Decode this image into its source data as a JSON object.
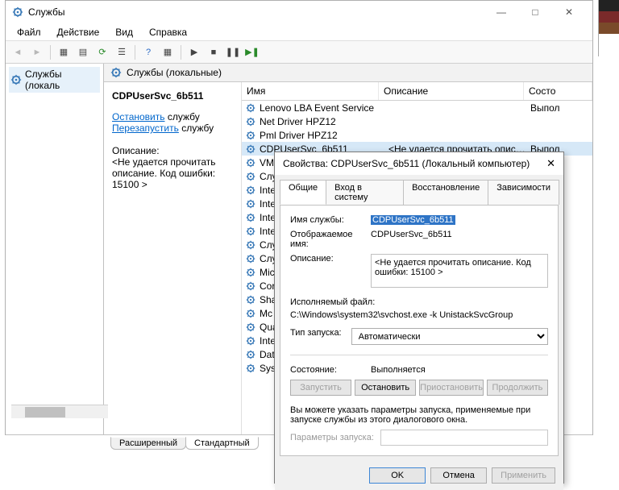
{
  "window": {
    "title": "Службы",
    "menu": [
      "Файл",
      "Действие",
      "Вид",
      "Справка"
    ],
    "win_ctrl": {
      "min": "—",
      "max": "□",
      "close": "✕"
    }
  },
  "tree": {
    "root": "Службы (локаль"
  },
  "main": {
    "header": "Службы (локальные)",
    "columns": {
      "name": "Имя",
      "desc": "Описание",
      "state": "Состо"
    },
    "tabs": {
      "ext": "Расширенный",
      "std": "Стандартный"
    }
  },
  "detail": {
    "svc": "CDPUserSvc_6b511",
    "stop_link": "Остановить",
    "stop_rest": " службу",
    "restart_link": "Перезапустить",
    "restart_rest": " службу",
    "desc_label": "Описание:",
    "desc_text": "<Не удается прочитать описание. Код ошибки: 15100 >"
  },
  "services": [
    {
      "name": "Lenovo LBA Event Service",
      "desc": "",
      "state": "Выпол"
    },
    {
      "name": "Net Driver HPZ12",
      "desc": "",
      "state": ""
    },
    {
      "name": "Pml Driver HPZ12",
      "desc": "",
      "state": ""
    },
    {
      "name": "CDPUserSvc_6b511",
      "desc": "<Не удается прочитать описание. Ко…",
      "state": "Выпол"
    },
    {
      "name": "VM",
      "desc": "",
      "state": ""
    },
    {
      "name": "Слу",
      "desc": "",
      "state": ""
    },
    {
      "name": "Inte",
      "desc": "",
      "state": ""
    },
    {
      "name": "Inte",
      "desc": "",
      "state": ""
    },
    {
      "name": "Inte",
      "desc": "",
      "state": ""
    },
    {
      "name": "Inte",
      "desc": "",
      "state": ""
    },
    {
      "name": "Слу",
      "desc": "",
      "state": ""
    },
    {
      "name": "Слу",
      "desc": "",
      "state": ""
    },
    {
      "name": "Mic",
      "desc": "",
      "state": ""
    },
    {
      "name": "Cor",
      "desc": "",
      "state": ""
    },
    {
      "name": "Sha",
      "desc": "",
      "state": ""
    },
    {
      "name": "Mc",
      "desc": "",
      "state": ""
    },
    {
      "name": "Qua",
      "desc": "",
      "state": ""
    },
    {
      "name": "Inte",
      "desc": "",
      "state": ""
    },
    {
      "name": "Data",
      "desc": "",
      "state": ""
    },
    {
      "name": "Syst",
      "desc": "",
      "state": ""
    }
  ],
  "dialog": {
    "title": "Свойства: CDPUserSvc_6b511 (Локальный компьютер)",
    "tabs": [
      "Общие",
      "Вход в систему",
      "Восстановление",
      "Зависимости"
    ],
    "name_lbl": "Имя службы:",
    "name_val": "CDPUserSvc_6b511",
    "disp_lbl": "Отображаемое имя:",
    "disp_val": "CDPUserSvc_6b511",
    "desc_lbl": "Описание:",
    "desc_val": "<Не удается прочитать описание. Код ошибки: 15100 >",
    "exe_lbl": "Исполняемый файл:",
    "exe_val": "C:\\Windows\\system32\\svchost.exe -k UnistackSvcGroup",
    "start_lbl": "Тип запуска:",
    "start_val": "Автоматически",
    "state_lbl": "Состояние:",
    "state_val": "Выполняется",
    "btns": {
      "run": "Запустить",
      "stop": "Остановить",
      "pause": "Приостановить",
      "cont": "Продолжить"
    },
    "hint": "Вы можете указать параметры запуска, применяемые при запуске службы из этого диалогового окна.",
    "param_lbl": "Параметры запуска:",
    "ok": "OK",
    "cancel": "Отмена",
    "apply": "Применить"
  }
}
